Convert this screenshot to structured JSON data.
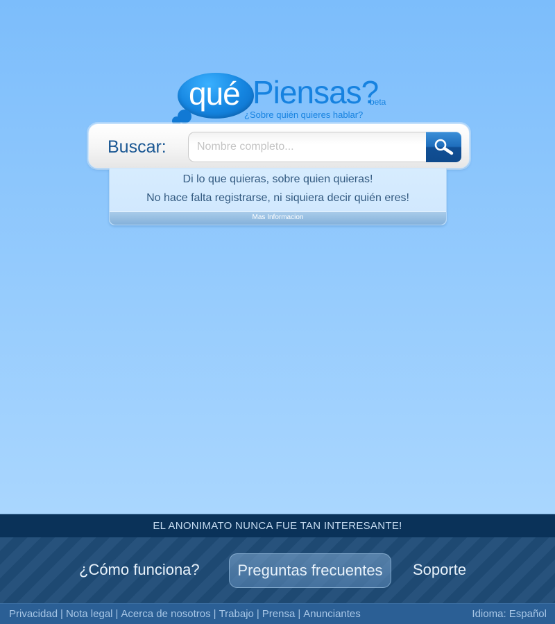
{
  "logo": {
    "que": "qué",
    "piensas": "Piensas?",
    "beta": "beta",
    "tagline": "¿Sobre quién quieres hablar?"
  },
  "search": {
    "label": "Buscar:",
    "placeholder": "Nombre completo...",
    "value": "",
    "button_icon": "magnifier-icon"
  },
  "info": {
    "line1": "Di lo que quieras, sobre quien quieras!",
    "line2": "No hace falta registrarse, ni siquiera decir quién eres!",
    "more_link": "Mas Informacion"
  },
  "footer": {
    "banner": "EL ANONIMATO NUNCA FUE TAN INTERESANTE!",
    "nav": [
      {
        "label": "¿Cómo funciona?",
        "active": false
      },
      {
        "label": "Preguntas frecuentes",
        "active": true
      },
      {
        "label": "Soporte",
        "active": false
      }
    ],
    "legal_links": [
      "Privacidad",
      "Nota legal",
      "Acerca de nosotros",
      "Trabajo",
      "Prensa",
      "Anunciantes"
    ],
    "separator": "|",
    "language": "Idioma: Español"
  },
  "colors": {
    "background_top": "#7cbdfb",
    "background_bottom": "#a9d6fe",
    "brand_blue": "#1682e0",
    "footer_dark": "#0a3259",
    "footer_nav": "#1f4c77",
    "footer_bottom": "#2b5f95"
  }
}
